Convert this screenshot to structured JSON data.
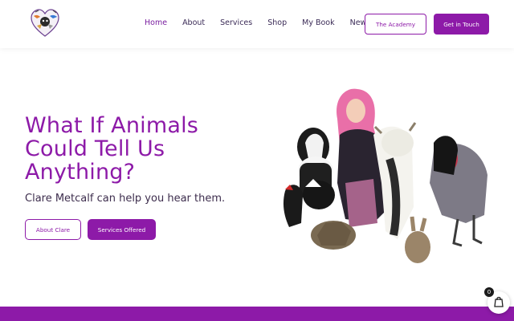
{
  "nav": {
    "items": [
      {
        "label": "Home",
        "active": true
      },
      {
        "label": "About"
      },
      {
        "label": "Services"
      },
      {
        "label": "Shop"
      },
      {
        "label": "My Book"
      },
      {
        "label": "News"
      }
    ],
    "academy_label": "The Academy",
    "contact_label": "Get in Touch"
  },
  "hero": {
    "title_lines": [
      "What If Animals",
      "Could Tell Us",
      "Anything?"
    ],
    "subtitle": "Clare Metcalf can help you hear them.",
    "about_label": "About Clare",
    "services_label": "Services Offered"
  },
  "cart": {
    "count": "0"
  },
  "colors": {
    "brand": "#8d1aa8",
    "text": "#3b2b57"
  },
  "icons": {
    "cart": "shopping-bag-icon",
    "logo": "heart-logo-icon"
  }
}
